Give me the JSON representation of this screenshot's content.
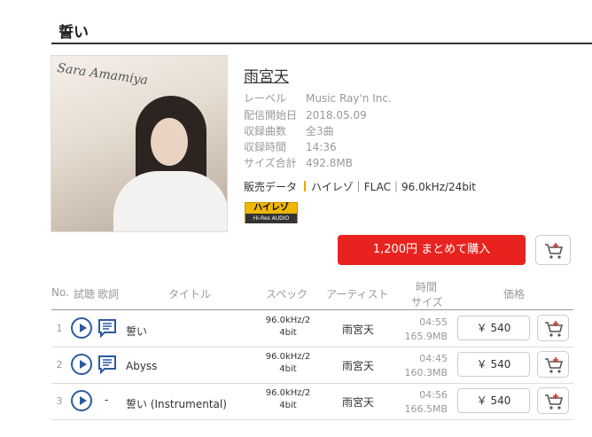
{
  "page": {
    "title": "誓い"
  },
  "album": {
    "cover_signature": "Sara Amamiya",
    "artist": "雨宮天",
    "details": [
      {
        "label": "レーベル",
        "value": "Music Ray'n Inc."
      },
      {
        "label": "配信開始日",
        "value": "2018.05.09"
      },
      {
        "label": "収録曲数",
        "value": "全3曲"
      },
      {
        "label": "収録時間",
        "value": "14:36"
      },
      {
        "label": "サイズ合計",
        "value": "492.8MB"
      }
    ],
    "sales_label": "販売データ",
    "sales_value": "ハイレゾ｜FLAC｜96.0kHz/24bit",
    "badge_main": "ハイレゾ",
    "badge_sub": "Hi-Res AUDIO"
  },
  "actions": {
    "buy_all_label": "1,200円 まとめて購入"
  },
  "table": {
    "headers": {
      "no": "No.",
      "listen": "試聴",
      "lyrics": "歌詞",
      "title": "タイトル",
      "spec": "スペック",
      "artist": "アーティスト",
      "time": "時間",
      "size": "サイズ",
      "price": "価格"
    },
    "rows": [
      {
        "no": "1",
        "lyrics": "",
        "title": "誓い",
        "spec1": "96.0kHz/2",
        "spec2": "4bit",
        "artist": "雨宮天",
        "time": "04:55",
        "size": "165.9MB",
        "price": "￥ 540"
      },
      {
        "no": "2",
        "lyrics": "",
        "title": "Abyss",
        "spec1": "96.0kHz/2",
        "spec2": "4bit",
        "artist": "雨宮天",
        "time": "04:45",
        "size": "160.3MB",
        "price": "￥ 540"
      },
      {
        "no": "3",
        "lyrics": "-",
        "title": "誓い (Instrumental)",
        "spec1": "96.0kHz/2",
        "spec2": "4bit",
        "artist": "雨宮天",
        "time": "04:56",
        "size": "166.5MB",
        "price": "￥ 540"
      }
    ]
  },
  "icons": {
    "play": "play-icon",
    "lyrics": "lyrics-icon",
    "cart": "add-to-cart-icon"
  },
  "colors": {
    "accent_red": "#e8231f",
    "play_blue": "#2c5aa0",
    "hires_gold": "#f0b700"
  }
}
